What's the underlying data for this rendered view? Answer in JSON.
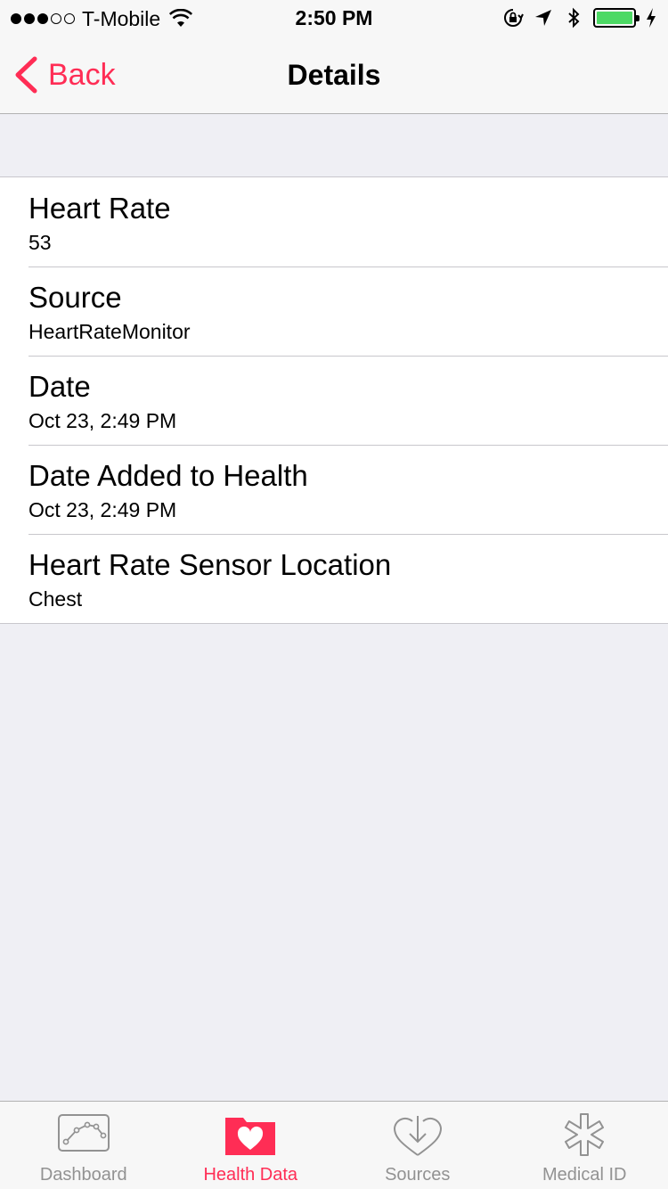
{
  "status_bar": {
    "carrier": "T-Mobile",
    "time": "2:50 PM",
    "signal_bars": 3,
    "signal_total": 5,
    "battery_color": "#4cd964"
  },
  "nav": {
    "back_label": "Back",
    "title": "Details"
  },
  "details": [
    {
      "label": "Heart Rate",
      "value": "53"
    },
    {
      "label": "Source",
      "value": "HeartRateMonitor"
    },
    {
      "label": "Date",
      "value": "Oct 23, 2:49 PM"
    },
    {
      "label": "Date Added to Health",
      "value": "Oct 23, 2:49 PM"
    },
    {
      "label": "Heart Rate Sensor Location",
      "value": "Chest"
    }
  ],
  "tabs": [
    {
      "label": "Dashboard",
      "icon": "dashboard-chart-icon",
      "active": false
    },
    {
      "label": "Health Data",
      "icon": "health-data-folder-heart-icon",
      "active": true
    },
    {
      "label": "Sources",
      "icon": "sources-download-heart-icon",
      "active": false
    },
    {
      "label": "Medical ID",
      "icon": "medical-star-icon",
      "active": false
    }
  ],
  "colors": {
    "accent": "#ff2d55",
    "inactive_tab": "#929292",
    "background": "#efeff4"
  }
}
